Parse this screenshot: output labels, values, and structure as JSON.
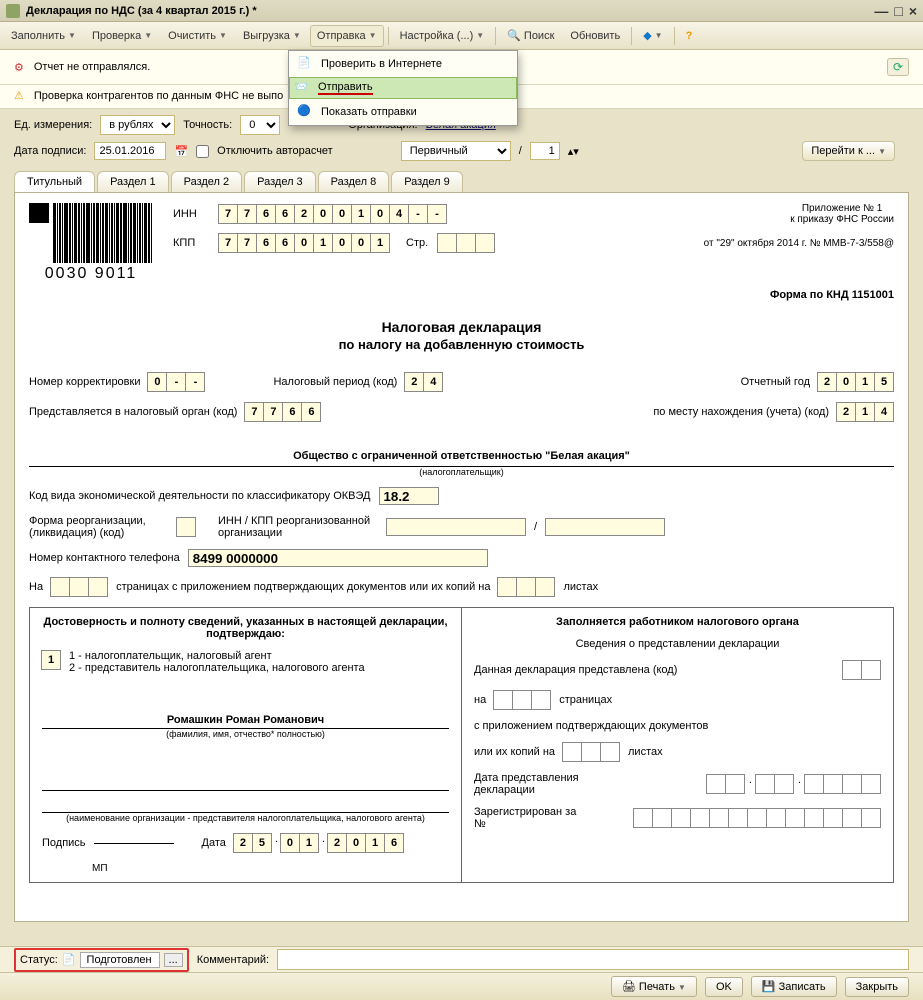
{
  "window": {
    "title": "Декларация по НДС (за 4 квартал 2015 г.) *"
  },
  "toolbar": {
    "fill": "Заполнить",
    "check": "Проверка",
    "clear": "Очистить",
    "export": "Выгрузка",
    "send": "Отправка",
    "settings": "Настройка (...)",
    "search": "Поиск",
    "refresh": "Обновить"
  },
  "dropdown": {
    "check_online": "Проверить в Интернете",
    "send": "Отправить",
    "show": "Показать отправки"
  },
  "msg": {
    "not_sent": "Отчет не отправлялся.",
    "fns_check": "Проверка контрагентов по данным ФНС не выпо"
  },
  "params": {
    "unit_label": "Ед. измерения:",
    "unit_value": "в рублях",
    "precision_label": "Точность:",
    "precision_value": "0",
    "org_label": "Организация:",
    "org_value": "Белая акация",
    "sign_date_label": "Дата подписи:",
    "sign_date": "25.01.2016",
    "autocalc": "Отключить авторасчет",
    "primary": "Первичный",
    "slash": "/",
    "num": "1",
    "goto": "Перейти к ..."
  },
  "tabs": [
    "Титульный",
    "Раздел 1",
    "Раздел 2",
    "Раздел 3",
    "Раздел 8",
    "Раздел 9"
  ],
  "doc": {
    "barcode": "0030 9011",
    "inn_label": "ИНН",
    "inn": [
      "7",
      "7",
      "6",
      "6",
      "2",
      "0",
      "0",
      "1",
      "0",
      "4",
      "-",
      "-"
    ],
    "kpp_label": "КПП",
    "kpp": [
      "7",
      "7",
      "6",
      "6",
      "0",
      "1",
      "0",
      "0",
      "1"
    ],
    "page_label": "Стр.",
    "appx": "Приложение № 1",
    "appx2": "к приказу ФНС России",
    "appx3": "от \"29\" октября 2014 г. № ММВ-7-3/558@",
    "title1": "Налоговая декларация",
    "title2": "по налогу на добавленную стоимость",
    "formcode": "Форма по КНД 1151001",
    "corr_label": "Номер корректировки",
    "corr": [
      "0",
      "-",
      "-"
    ],
    "period_label": "Налоговый период  (код)",
    "period": [
      "2",
      "4"
    ],
    "year_label": "Отчетный год",
    "year": [
      "2",
      "0",
      "1",
      "5"
    ],
    "tax_org_label": "Представляется в налоговый орган   (код)",
    "tax_org": [
      "7",
      "7",
      "6",
      "6"
    ],
    "place_label": "по месту нахождения (учета)  (код)",
    "place": [
      "2",
      "1",
      "4"
    ],
    "org_full": "Общество с ограниченной ответственностью \"Белая акация\"",
    "taxpayer_note": "(налогоплательщик)",
    "okved_label": "Код вида экономической деятельности по классификатору ОКВЭД",
    "okved": "18.2",
    "reorg_label": "Форма реорганизации, (ликвидация) (код)",
    "reorg_inn_label": "ИНН / КПП реорганизованной организации",
    "phone_label": "Номер контактного телефона",
    "phone": "8499 0000000",
    "pages1": "На",
    "pages2": "страницах с приложением подтверждающих документов или их копий на",
    "pages3": "листах",
    "left_header": "Достоверность и полноту сведений, указанных в настоящей декларации, подтверждаю:",
    "signer_code": "1",
    "signer1": "1 - налогоплательщик, налоговый агент",
    "signer2": "2 - представитель налогоплательщика, налогового агента",
    "rep_name": "Ромашкин Роман Романович",
    "fio_note": "(фамилия, имя, отчество* полностью)",
    "org_rep_note": "(наименование организации - представителя налогоплательщика, налогового агента)",
    "sign_label": "Подпись",
    "mp": "МП",
    "date_label": "Дата",
    "sign_date": [
      "2",
      "5",
      ".",
      "0",
      "1",
      ".",
      "2",
      "0",
      "1",
      "6"
    ],
    "right_header": "Заполняется работником налогового органа",
    "right_sub": "Сведения о представлении декларации",
    "r1": "Данная декларация представлена  (код)",
    "r2a": "на",
    "r2b": "страницах",
    "r3a": "с приложением подтверждающих документов",
    "r3b": "или их копий на",
    "r3c": "листах",
    "r4": "Дата представления декларации",
    "r5": "Зарегистрирован за №"
  },
  "status": {
    "label": "Статус:",
    "value": "Подготовлен",
    "comment_label": "Комментарий:"
  },
  "footer": {
    "print": "Печать",
    "ok": "OK",
    "save": "Записать",
    "close": "Закрыть"
  }
}
